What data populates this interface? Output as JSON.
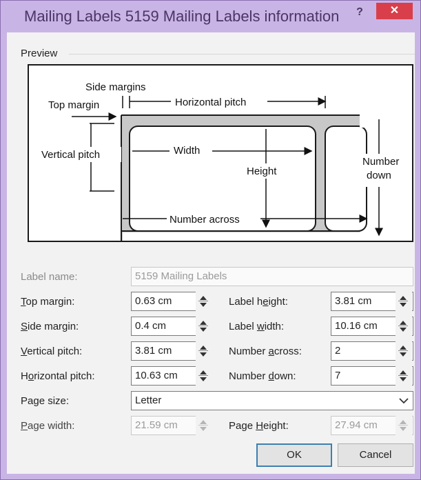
{
  "window": {
    "title": "Mailing Labels 5159 Mailing Labels information",
    "help_label": "?",
    "close_label": "✕"
  },
  "preview": {
    "section_label": "Preview",
    "diagram": {
      "side_margins": "Side margins",
      "top_margin": "Top margin",
      "horizontal_pitch": "Horizontal pitch",
      "vertical_pitch": "Vertical pitch",
      "width": "Width",
      "height": "Height",
      "number_down_1": "Number",
      "number_down_2": "down",
      "number_across": "Number across"
    }
  },
  "form": {
    "label_name": {
      "label": "Label name:",
      "value": "5159 Mailing Labels"
    },
    "top_margin": {
      "label_pre": "",
      "label_u": "T",
      "label_post": "op margin:",
      "value": "0.63 cm"
    },
    "side_margin": {
      "label_pre": "",
      "label_u": "S",
      "label_post": "ide margin:",
      "value": "0.4 cm"
    },
    "vertical_pitch": {
      "label_pre": "",
      "label_u": "V",
      "label_post": "ertical pitch:",
      "value": "3.81 cm"
    },
    "horizontal_pitch": {
      "label_pre": "H",
      "label_u": "o",
      "label_post": "rizontal pitch:",
      "value": "10.63 cm"
    },
    "page_size": {
      "label": "Page size:",
      "value": "Letter"
    },
    "page_width": {
      "label_pre": "",
      "label_u": "P",
      "label_post": "age width:",
      "value": "21.59 cm"
    },
    "label_height": {
      "label_pre": "Label h",
      "label_u": "e",
      "label_post": "ight:",
      "value": "3.81 cm"
    },
    "label_width": {
      "label_pre": "Label ",
      "label_u": "w",
      "label_post": "idth:",
      "value": "10.16 cm"
    },
    "number_across": {
      "label_pre": "Number ",
      "label_u": "a",
      "label_post": "cross:",
      "value": "2"
    },
    "number_down": {
      "label_pre": "Number ",
      "label_u": "d",
      "label_post": "own:",
      "value": "7"
    },
    "page_height": {
      "label_pre": "Page ",
      "label_u": "H",
      "label_post": "eight:",
      "value": "27.94 cm"
    }
  },
  "buttons": {
    "ok": "OK",
    "cancel": "Cancel"
  },
  "colors": {
    "title_bar": "#c9b4e6",
    "close": "#d93f4a",
    "default_button_border": "#3c7fb1"
  }
}
